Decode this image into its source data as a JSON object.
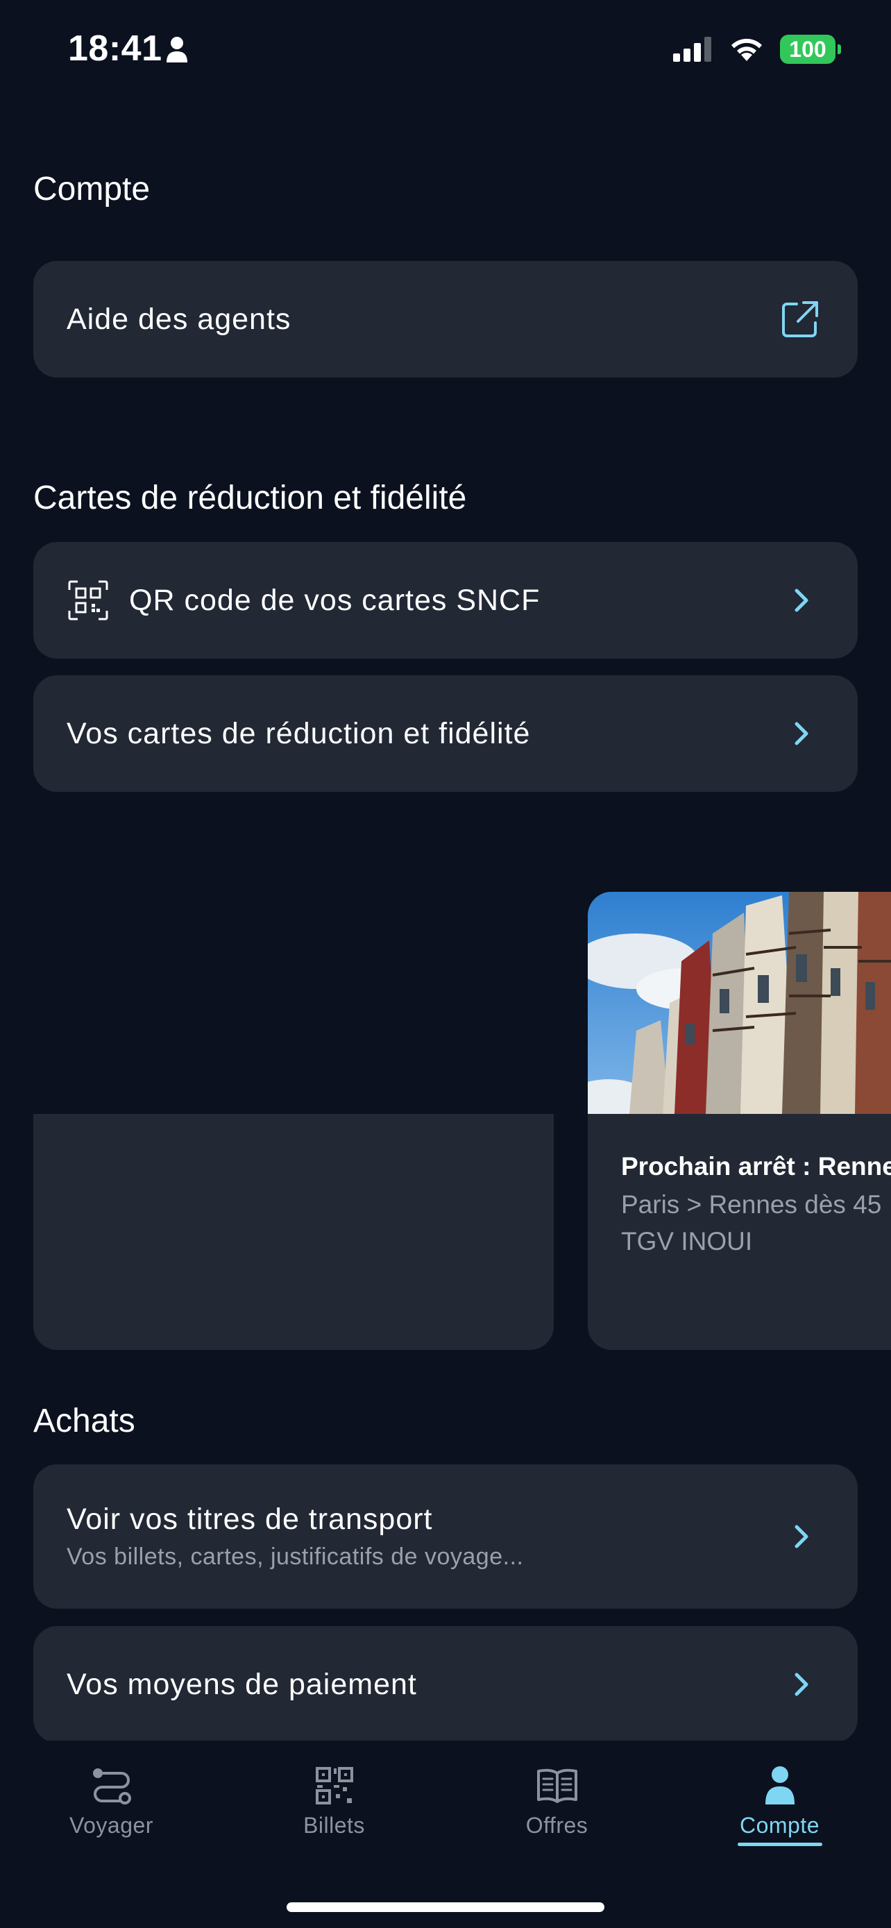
{
  "status": {
    "time": "18:41",
    "battery": "100"
  },
  "sections": {
    "compte": "Compte",
    "cartes": "Cartes de réduction et fidélité",
    "achats": "Achats"
  },
  "items": {
    "aide_agents": "Aide des agents",
    "qr_code": "QR code de vos cartes SNCF",
    "vos_cartes": "Vos cartes de réduction et fidélité",
    "titres": "Voir vos titres de transport",
    "titres_sub": "Vos billets, cartes, justificatifs de voyage...",
    "paiement": "Vos moyens de paiement"
  },
  "promo": {
    "title": "Prochain arrêt : Renne",
    "line1": "Paris > Rennes dès 45",
    "line2": "TGV INOUI"
  },
  "tabs": [
    {
      "label": "Voyager",
      "icon": "route-icon"
    },
    {
      "label": "Billets",
      "icon": "qr-code-icon"
    },
    {
      "label": "Offres",
      "icon": "open-book-icon"
    },
    {
      "label": "Compte",
      "icon": "person-icon",
      "active": true
    }
  ],
  "colors": {
    "accent": "#7fd6f3",
    "background": "#0b111e",
    "card": "#222834",
    "battery": "#32c75a"
  }
}
